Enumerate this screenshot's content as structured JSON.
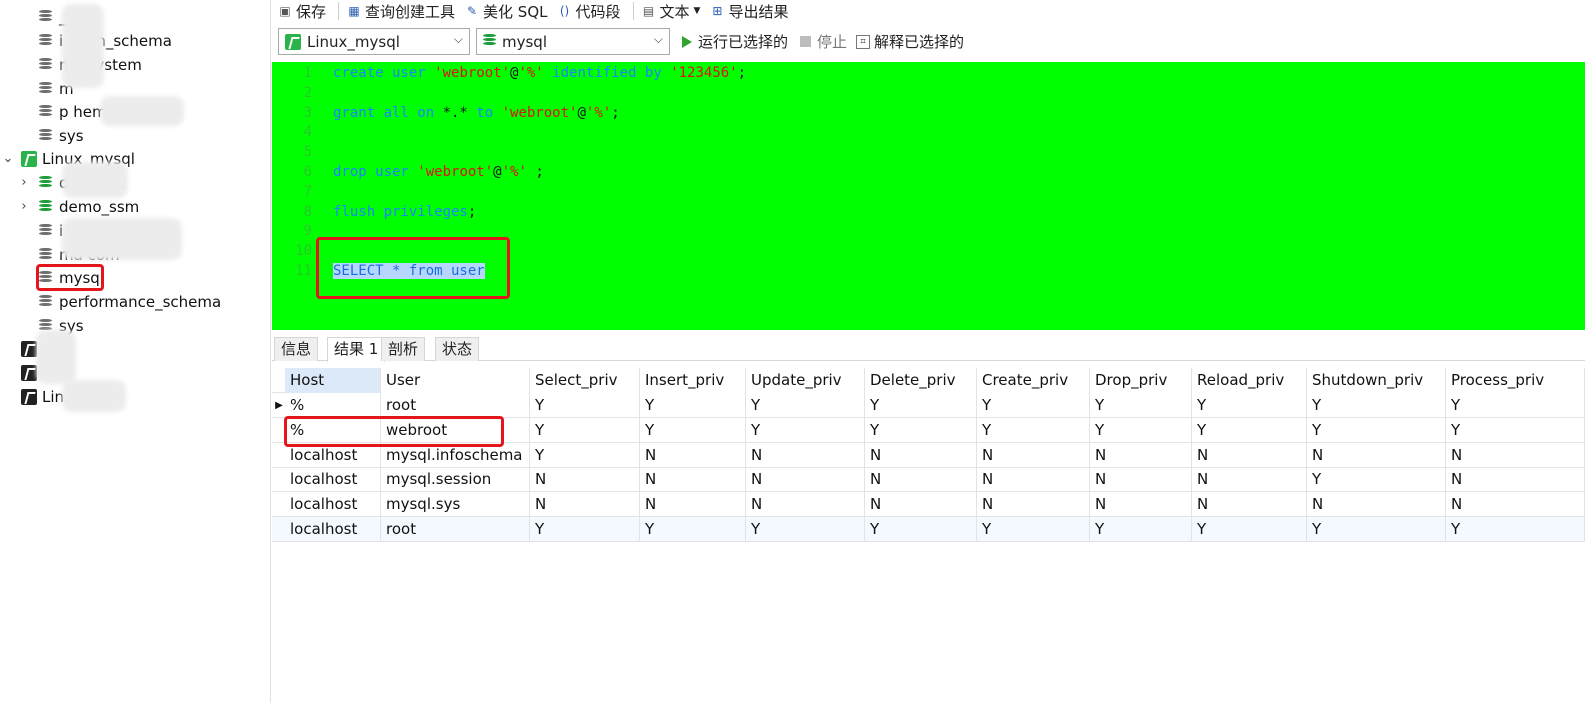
{
  "toolbar": {
    "save": "保存",
    "query_builder": "查询创建工具",
    "beautify": "美化 SQL",
    "snippet": "代码段",
    "text": "文本",
    "export": "导出结果"
  },
  "selectors": {
    "connection": "Linux_mysql",
    "database": "mysql",
    "run_selected": "运行已选择的",
    "stop": "停止",
    "explain_selected": "解释已选择的"
  },
  "sidebar": {
    "items": [
      {
        "label": "_ssm"
      },
      {
        "label": "i        ation_schema"
      },
      {
        "label": "m     esystem"
      },
      {
        "label": "m"
      },
      {
        "label": "p                   hema"
      },
      {
        "label": "sys"
      },
      {
        "label": "Linux_mysql"
      },
      {
        "label": "d            project"
      },
      {
        "label": "demo_ssm"
      },
      {
        "label": "i                  ma"
      },
      {
        "label": "ma            com"
      },
      {
        "label": "mysql"
      },
      {
        "label": "performance_schema"
      },
      {
        "label": "sys"
      },
      {
        "label": ""
      },
      {
        "label": "         ot"
      },
      {
        "label": "Lin              oDB"
      }
    ]
  },
  "editor": {
    "lines": [
      {
        "n": "1",
        "parts": [
          {
            "t": "create user ",
            "c": "kw"
          },
          {
            "t": "'webroot'",
            "c": "str"
          },
          {
            "t": "@",
            "c": "plain"
          },
          {
            "t": "'%'",
            "c": "str"
          },
          {
            "t": " identified by ",
            "c": "kw"
          },
          {
            "t": "'123456'",
            "c": "str"
          },
          {
            "t": ";",
            "c": "plain"
          }
        ]
      },
      {
        "n": "2",
        "parts": []
      },
      {
        "n": "3",
        "parts": [
          {
            "t": "grant all on ",
            "c": "kw"
          },
          {
            "t": "*.* ",
            "c": "plain"
          },
          {
            "t": "to ",
            "c": "kw"
          },
          {
            "t": "'webroot'",
            "c": "str"
          },
          {
            "t": "@",
            "c": "plain"
          },
          {
            "t": "'%'",
            "c": "str"
          },
          {
            "t": ";",
            "c": "plain"
          }
        ]
      },
      {
        "n": "4",
        "parts": []
      },
      {
        "n": "5",
        "parts": []
      },
      {
        "n": "6",
        "parts": [
          {
            "t": "drop user ",
            "c": "kw"
          },
          {
            "t": "'webroot'",
            "c": "str"
          },
          {
            "t": "@",
            "c": "plain"
          },
          {
            "t": "'%'",
            "c": "str"
          },
          {
            "t": " ;",
            "c": "plain"
          }
        ]
      },
      {
        "n": "7",
        "parts": []
      },
      {
        "n": "8",
        "parts": [
          {
            "t": "flush privileges",
            "c": "kw"
          },
          {
            "t": ";",
            "c": "plain"
          }
        ]
      },
      {
        "n": "9",
        "parts": []
      },
      {
        "n": "10",
        "parts": []
      },
      {
        "n": "11",
        "parts": [
          {
            "t": "SELECT * from user",
            "c": "sel"
          }
        ]
      }
    ]
  },
  "tabs": [
    "信息",
    "结果 1",
    "剖析",
    "状态"
  ],
  "grid": {
    "columns": [
      "Host",
      "User",
      "Select_priv",
      "Insert_priv",
      "Update_priv",
      "Delete_priv",
      "Create_priv",
      "Drop_priv",
      "Reload_priv",
      "Shutdown_priv",
      "Process_priv"
    ],
    "rows": [
      [
        "%",
        "root",
        "Y",
        "Y",
        "Y",
        "Y",
        "Y",
        "Y",
        "Y",
        "Y",
        "Y"
      ],
      [
        "%",
        "webroot",
        "Y",
        "Y",
        "Y",
        "Y",
        "Y",
        "Y",
        "Y",
        "Y",
        "Y"
      ],
      [
        "localhost",
        "mysql.infoschema",
        "Y",
        "N",
        "N",
        "N",
        "N",
        "N",
        "N",
        "N",
        "N"
      ],
      [
        "localhost",
        "mysql.session",
        "N",
        "N",
        "N",
        "N",
        "N",
        "N",
        "N",
        "Y",
        "N"
      ],
      [
        "localhost",
        "mysql.sys",
        "N",
        "N",
        "N",
        "N",
        "N",
        "N",
        "N",
        "N",
        "N"
      ],
      [
        "localhost",
        "root",
        "Y",
        "Y",
        "Y",
        "Y",
        "Y",
        "Y",
        "Y",
        "Y",
        "Y"
      ]
    ]
  },
  "colors": {
    "editor_bg": "#00ff00",
    "keyword": "#1a84ff",
    "string": "#e01010",
    "highlight_box": "#e3161b"
  }
}
